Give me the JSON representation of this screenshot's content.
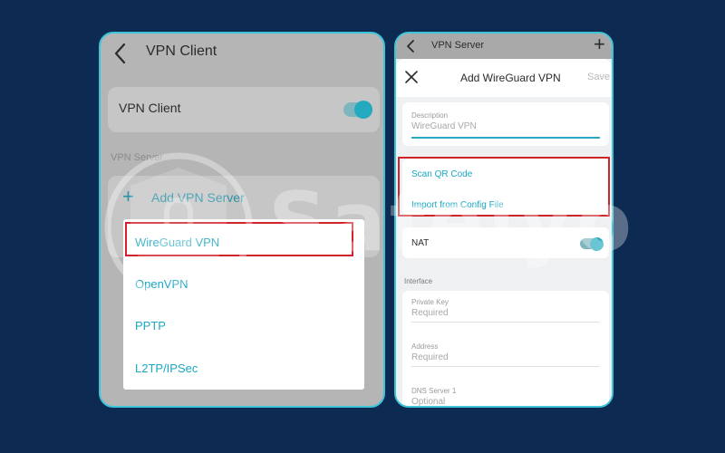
{
  "left": {
    "title": "VPN Client",
    "card_label": "VPN Client",
    "toggle_on": true,
    "section_label": "VPN Server",
    "add_label": "Add VPN Server",
    "popup_items": [
      "WireGuard VPN",
      "OpenVPN",
      "PPTP",
      "L2TP/IPSec"
    ]
  },
  "right": {
    "status_title": "VPN Server",
    "header_title": "Add WireGuard VPN",
    "save_label": "Save",
    "description": {
      "label": "Description",
      "value": "WireGuard VPN"
    },
    "import": {
      "scan": "Scan QR Code",
      "config": "Import from Config File"
    },
    "nat": {
      "label": "NAT",
      "on": true
    },
    "interface_section": "Interface",
    "fields": [
      {
        "label": "Private Key",
        "value": "Required"
      },
      {
        "label": "Address",
        "value": "Required"
      },
      {
        "label": "DNS Server 1",
        "value": "Optional"
      }
    ]
  },
  "watermark": "Safelyo",
  "colors": {
    "accent": "#1ba8c4",
    "highlight": "#d0242b",
    "background": "#0c2a52",
    "frame": "#3cc4d9"
  }
}
